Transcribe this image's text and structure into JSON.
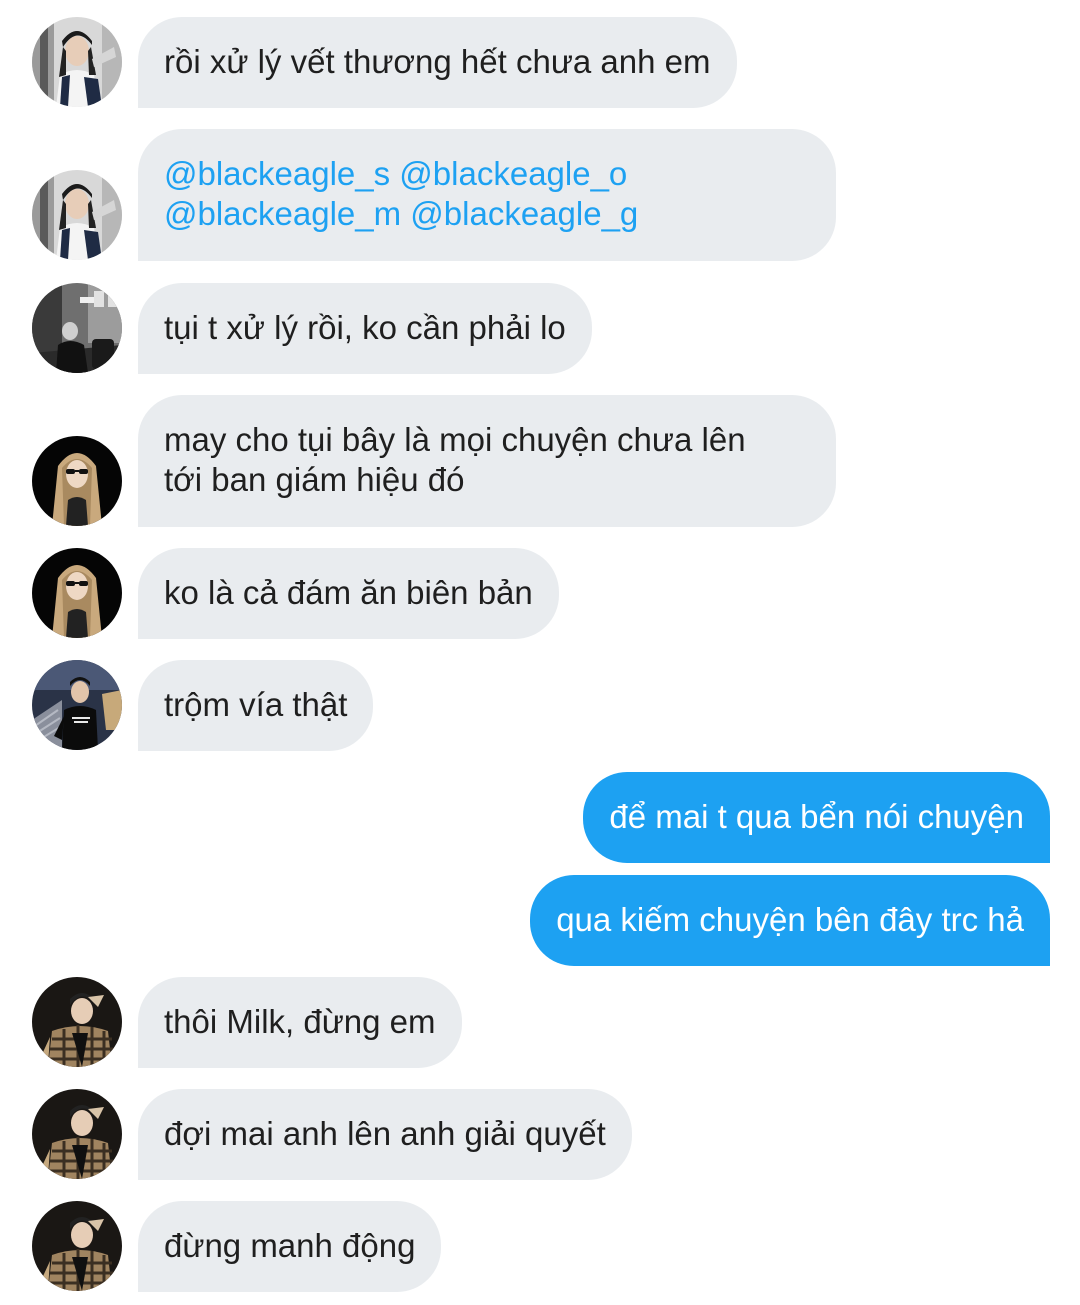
{
  "colors": {
    "incoming_bubble": "#e9ecef",
    "outgoing_bubble": "#1da1f2",
    "mention": "#1da1f2",
    "text_dark": "#1f1f1f"
  },
  "messages": [
    {
      "direction": "in",
      "avatar": "user-avatar-girl-cap",
      "text": "rồi xử lý vết thương hết chưa anh em"
    },
    {
      "direction": "in",
      "avatar": "user-avatar-girl-cap",
      "line1": "@blackeagle_s @blackeagle_o",
      "line2": "@blackeagle_m @blackeagle_g"
    },
    {
      "direction": "in",
      "avatar": "user-avatar-bw-street",
      "text": "tụi t xử lý rồi, ko cần phải lo"
    },
    {
      "direction": "in",
      "avatar": "user-avatar-blonde-sunglasses",
      "line1": "may cho tụi bây là mọi chuyện chưa lên",
      "line2": "tới ban giám hiệu đó"
    },
    {
      "direction": "in",
      "avatar": "user-avatar-blonde-sunglasses",
      "text": "ko là cả đám ăn biên bản"
    },
    {
      "direction": "in",
      "avatar": "user-avatar-night-jacket",
      "text": "trộm vía thật"
    },
    {
      "direction": "out",
      "text": "để mai t qua bển nói chuyện"
    },
    {
      "direction": "out",
      "text": "qua kiếm chuyện bên đây trc hả"
    },
    {
      "direction": "in",
      "avatar": "user-avatar-plaid-shirt",
      "text": "thôi Milk, đừng em"
    },
    {
      "direction": "in",
      "avatar": "user-avatar-plaid-shirt",
      "text": "đợi mai anh lên anh giải quyết"
    },
    {
      "direction": "in",
      "avatar": "user-avatar-plaid-shirt",
      "text": "đừng manh động"
    }
  ]
}
